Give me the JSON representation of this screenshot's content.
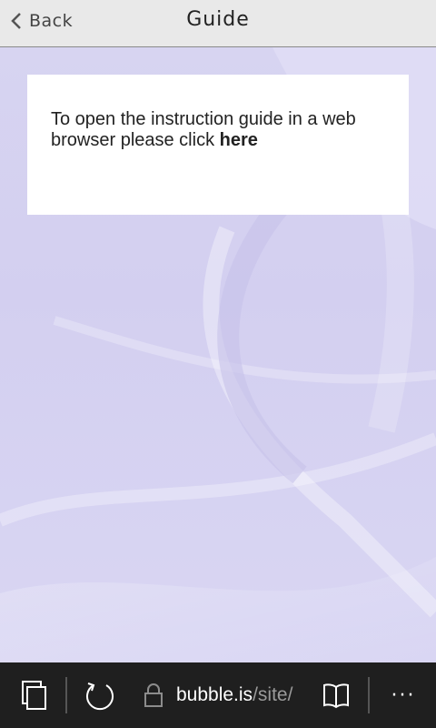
{
  "header": {
    "back_label": "Back",
    "title": "Guide"
  },
  "card": {
    "text": "To open the instruction guide in a web browser please click ",
    "link_label": "here"
  },
  "browser_toolbar": {
    "domain": "bubble.is",
    "path": "/site/",
    "icons": [
      "tabs-icon",
      "refresh-icon",
      "lock-icon",
      "reading-view-icon",
      "more-icon"
    ],
    "more_label": "···"
  },
  "colors": {
    "header_bg": "#e9e9e9",
    "content_bg": "#d5d2f1",
    "toolbar_bg": "#1f1f1f",
    "card_bg": "#ffffff"
  }
}
